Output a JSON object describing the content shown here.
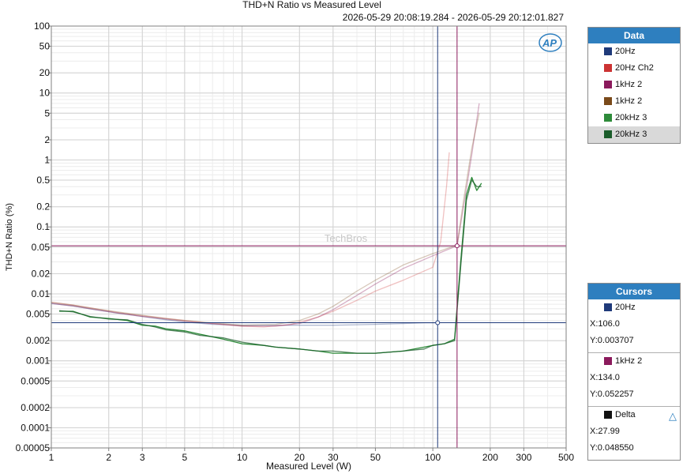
{
  "chart_data": {
    "type": "line",
    "title": "THD+N Ratio vs Measured Level",
    "subtitle": "2026-05-29 20:08:19.284 - 2026-05-29 20:12:01.827",
    "xlabel": "Measured Level (W)",
    "ylabel": "THD+N Ratio (%)",
    "x_scale": "log",
    "y_scale": "log",
    "xlim": [
      1,
      500
    ],
    "ylim": [
      5e-05,
      100
    ],
    "x_ticks": [
      1,
      2,
      3,
      5,
      10,
      20,
      30,
      50,
      100,
      200,
      300,
      500
    ],
    "x_tick_labels": [
      "1",
      "2",
      "3",
      "5",
      "10",
      "20",
      "30",
      "50",
      "100",
      "200",
      "300",
      "500"
    ],
    "y_ticks": [
      100,
      50,
      20,
      10,
      5,
      2,
      1,
      0.5,
      0.2,
      0.1,
      0.05,
      0.02,
      0.01,
      0.005,
      0.002,
      0.001,
      0.0005,
      0.0002,
      0.0001,
      5e-05
    ],
    "y_tick_labels": [
      "100",
      "50",
      "20",
      "10",
      "5",
      "2",
      "1",
      "0.5",
      "0.2",
      "0.1",
      "0.05",
      "0.02",
      "0.01",
      "0.005",
      "0.002",
      "0.001",
      "0.0005",
      "0.0002",
      "0.0001",
      "0.00005"
    ],
    "grid": true,
    "watermark": "TechBros",
    "logo": "AP",
    "series": [
      {
        "name": "20Hz",
        "color": "#1f3a7a",
        "opacity": 0.35,
        "x": [
          1,
          1.3,
          1.7,
          2.2,
          3,
          4,
          5,
          7,
          10,
          15,
          20,
          30,
          50,
          70,
          90,
          100,
          106
        ],
        "y": [
          0.0072,
          0.0066,
          0.0058,
          0.0052,
          0.0046,
          0.0041,
          0.0038,
          0.0035,
          0.0034,
          0.0034,
          0.0034,
          0.0034,
          0.0035,
          0.0036,
          0.0037,
          0.0037,
          0.0037
        ]
      },
      {
        "name": "20Hz Ch2",
        "color": "#cc3333",
        "opacity": 0.3,
        "x": [
          1,
          1.3,
          1.7,
          2.2,
          3,
          4,
          5,
          7,
          10,
          13,
          18,
          25,
          30,
          40,
          50,
          70,
          100,
          110,
          118,
          122
        ],
        "y": [
          0.0075,
          0.0068,
          0.006,
          0.0053,
          0.0047,
          0.0043,
          0.004,
          0.0036,
          0.0033,
          0.0032,
          0.0035,
          0.0045,
          0.0055,
          0.008,
          0.011,
          0.016,
          0.025,
          0.06,
          0.4,
          1.3
        ]
      },
      {
        "name": "1kHz 2",
        "color": "#8b1a5c",
        "opacity": 0.35,
        "x": [
          1,
          1.3,
          1.7,
          2.2,
          3,
          4,
          5,
          7,
          10,
          15,
          20,
          25,
          30,
          40,
          50,
          70,
          100,
          120,
          134,
          145,
          160,
          175
        ],
        "y": [
          0.0072,
          0.0066,
          0.0058,
          0.0052,
          0.0046,
          0.0042,
          0.0039,
          0.0036,
          0.0033,
          0.0033,
          0.0036,
          0.0045,
          0.0058,
          0.0095,
          0.014,
          0.024,
          0.037,
          0.046,
          0.052,
          0.2,
          1.2,
          7
        ]
      },
      {
        "name": "1kHz 2",
        "color": "#7a4a1a",
        "opacity": 0.3,
        "x": [
          1,
          1.3,
          1.7,
          2.2,
          3,
          4,
          5,
          7,
          10,
          15,
          20,
          25,
          30,
          40,
          50,
          70,
          100,
          120,
          134,
          145,
          160,
          175
        ],
        "y": [
          0.0075,
          0.0068,
          0.006,
          0.0054,
          0.0048,
          0.0043,
          0.004,
          0.0037,
          0.0034,
          0.0035,
          0.004,
          0.005,
          0.0065,
          0.011,
          0.016,
          0.027,
          0.04,
          0.048,
          0.054,
          0.25,
          1.5,
          5
        ]
      },
      {
        "name": "20kHz 3",
        "color": "#2e8b3a",
        "opacity": 1.0,
        "x": [
          1.1,
          1.3,
          1.6,
          2,
          2.5,
          3,
          3.5,
          4,
          5,
          6,
          8,
          10,
          13,
          15,
          20,
          25,
          30,
          40,
          50,
          70,
          90,
          100,
          115,
          130,
          140,
          150,
          160,
          170,
          180
        ],
        "y": [
          0.0055,
          0.0055,
          0.0045,
          0.0043,
          0.004,
          0.0034,
          0.0033,
          0.003,
          0.0028,
          0.0025,
          0.0021,
          0.0018,
          0.0017,
          0.0016,
          0.0015,
          0.0014,
          0.0013,
          0.0013,
          0.0013,
          0.0014,
          0.0016,
          0.0017,
          0.0018,
          0.0021,
          0.03,
          0.3,
          0.55,
          0.35,
          0.45
        ]
      },
      {
        "name": "20kHz 3",
        "color": "#1a5c2a",
        "opacity": 0.75,
        "x": [
          1.1,
          1.3,
          1.6,
          2,
          2.5,
          3,
          3.5,
          4,
          5,
          6,
          8,
          10,
          13,
          15,
          20,
          25,
          30,
          40,
          50,
          70,
          90,
          100,
          115,
          130,
          140,
          150,
          160,
          170,
          180
        ],
        "y": [
          0.0056,
          0.0054,
          0.0046,
          0.0042,
          0.0041,
          0.0035,
          0.0032,
          0.0029,
          0.0027,
          0.0024,
          0.0022,
          0.0019,
          0.0017,
          0.0016,
          0.0015,
          0.0014,
          0.0014,
          0.0013,
          0.0013,
          0.0014,
          0.0015,
          0.0017,
          0.0018,
          0.002,
          0.025,
          0.25,
          0.5,
          0.4,
          0.4
        ]
      }
    ],
    "cursors": [
      {
        "x": 106.0,
        "y": 0.003707,
        "color": "#1f3a7a"
      },
      {
        "x": 134.0,
        "y": 0.052257,
        "color": "#8b1a5c"
      }
    ]
  },
  "legend": {
    "title": "Data",
    "items": [
      {
        "label": "20Hz",
        "color": "#1f3a7a",
        "selected": false
      },
      {
        "label": "20Hz Ch2",
        "color": "#cc3333",
        "selected": false
      },
      {
        "label": "1kHz 2",
        "color": "#8b1a5c",
        "selected": false
      },
      {
        "label": "1kHz 2",
        "color": "#7a4a1a",
        "selected": false
      },
      {
        "label": "20kHz 3",
        "color": "#2e8b3a",
        "selected": false
      },
      {
        "label": "20kHz 3",
        "color": "#1a5c2a",
        "selected": true
      }
    ]
  },
  "cursors_panel": {
    "title": "Cursors",
    "groups": [
      {
        "name": "20Hz",
        "color": "#1f3a7a",
        "x_text": "X:106.0",
        "y_text": "Y:0.003707"
      },
      {
        "name": "1kHz 2",
        "color": "#8b1a5c",
        "x_text": "X:134.0",
        "y_text": "Y:0.052257"
      },
      {
        "name": "Delta",
        "color": "#111111",
        "x_text": "X:27.99",
        "y_text": "Y:0.048550"
      }
    ]
  }
}
